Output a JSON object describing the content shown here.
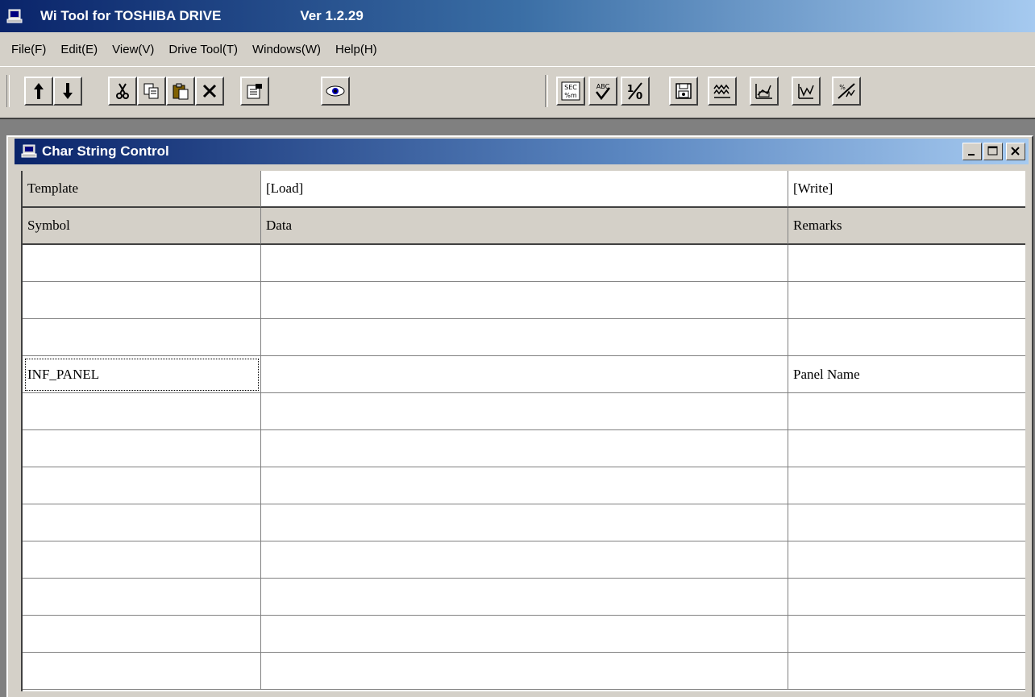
{
  "app": {
    "title": "Wi Tool  for TOSHIBA DRIVE",
    "version": "Ver 1.2.29",
    "icon": "computer-icon"
  },
  "menu": [
    "File(F)",
    "Edit(E)",
    "View(V)",
    "Drive Tool(T)",
    "Windows(W)",
    "Help(H)"
  ],
  "toolbar": {
    "buttons": [
      "arrow-up-icon",
      "arrow-down-icon",
      "cut-icon",
      "copy-icon",
      "paste-icon",
      "delete-icon",
      "properties-icon",
      "monitor-eye-icon",
      "time-setting-icon",
      "check-icon",
      "fraction-icon",
      "save-disk-icon",
      "waveform-icon",
      "trend-icon",
      "graph-icon",
      "compare-icon"
    ]
  },
  "child_window": {
    "title": "Char String Control",
    "icon": "computer-icon",
    "controls": [
      "minimize-icon",
      "maximize-icon",
      "close-icon"
    ]
  },
  "grid": {
    "template_row": [
      "Template",
      "[Load]",
      "[Write]"
    ],
    "columns": [
      "Symbol",
      "Data",
      "Remarks"
    ],
    "rows": [
      [
        "",
        "",
        ""
      ],
      [
        "",
        "",
        ""
      ],
      [
        "",
        "",
        ""
      ],
      [
        "INF_PANEL",
        "",
        "Panel Name"
      ],
      [
        "",
        "",
        ""
      ],
      [
        "",
        "",
        ""
      ],
      [
        "",
        "",
        ""
      ],
      [
        "",
        "",
        ""
      ],
      [
        "",
        "",
        ""
      ],
      [
        "",
        "",
        ""
      ],
      [
        "",
        "",
        ""
      ],
      [
        "",
        "",
        ""
      ]
    ]
  }
}
